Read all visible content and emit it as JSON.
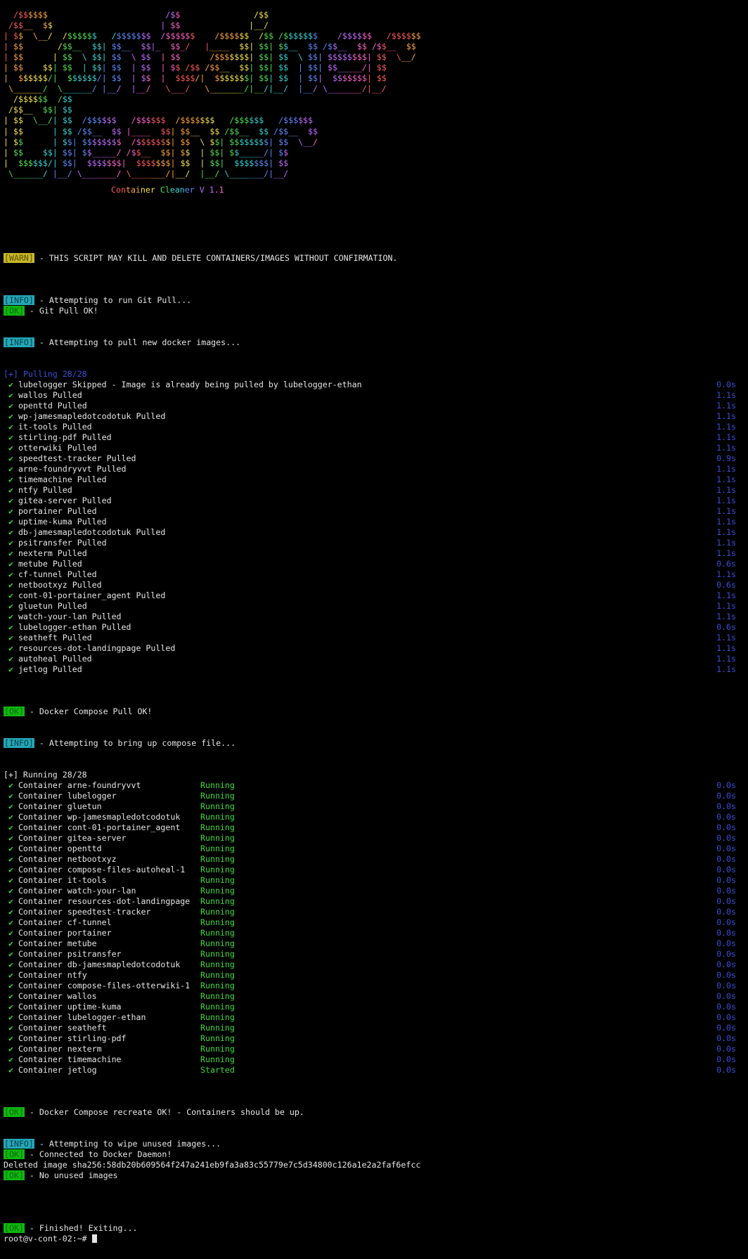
{
  "banner_lines": [
    "  /$$$$$$                        /$$               /$$",
    " /$$__  $$                      | $$              |__/",
    "| $$  \\__/  /$$$$$$   /$$$$$$$  /$$$$$$    /$$$$$$  /$$ /$$$$$$$    /$$$$$$   /$$$$$$",
    "| $$       /$$__  $$| $$__  $$|_  $$_/   |____  $$| $$| $$__  $$ /$$__  $$ /$$__  $$",
    "| $$      | $$  \\ $$| $$  \\ $$  | $$      /$$$$$$$| $$| $$  \\ $$| $$$$$$$$| $$  \\__/",
    "| $$    $$| $$  | $$| $$  | $$  | $$ /$$ /$$__  $$| $$| $$  | $$| $$_____/| $$",
    "|  $$$$$$/|  $$$$$$/| $$  | $$  |  $$$$/|  $$$$$$$| $$| $$  | $$|  $$$$$$$| $$",
    " \\______/  \\______/ |__/  |__/   \\___/   \\_______/|__/|__/  |__/ \\_______/|__/",
    "  /$$$$$$  /$$",
    " /$$__  $$| $$",
    "| $$  \\__/| $$  /$$$$$$   /$$$$$$  /$$$$$$$   /$$$$$$   /$$$$$$",
    "| $$      | $$ /$$__  $$ |____  $$| $$__  $$ /$$__  $$ /$$__  $$",
    "| $$      | $$| $$$$$$$$  /$$$$$$$| $$  \\ $$| $$$$$$$$| $$  \\__/",
    "| $$    $$| $$| $$_____/ /$$__  $$| $$  | $$| $$_____/| $$",
    "|  $$$$$$/| $$|  $$$$$$$|  $$$$$$$| $$  | $$|  $$$$$$$| $$",
    " \\______/ |__/ \\_______/ \\_______/|__/  |__/ \\_______/|__/"
  ],
  "subtitle": "Container Cleaner V 1.1",
  "tags": {
    "warn": "[WARN]",
    "info": "[INFO]",
    "ok": "[OK]"
  },
  "messages": {
    "warn": " - THIS SCRIPT MAY KILL AND DELETE CONTAINERS/IMAGES WITHOUT CONFIRMATION.",
    "git_attempt": " - Attempting to run Git Pull...",
    "git_ok": " - Git Pull OK!",
    "pull_attempt": " - Attempting to pull new docker images...",
    "pull_ok": " - Docker Compose Pull OK!",
    "up_attempt": " - Attempting to bring up compose file...",
    "recreate_ok": " - Docker Compose recreate OK! - Containers should be up.",
    "wipe_attempt": " - Attempting to wipe unused images...",
    "daemon_ok": " - Connected to Docker Daemon!",
    "deleted": "Deleted image sha256:58db20b609564f247a241eb9fa3a83c55779e7c5d34800c126a1e2a2faf6efcc",
    "no_unused": " - No unused images",
    "finished": " - Finished! Exiting..."
  },
  "pulling": {
    "header": "[+] Pulling 28/28",
    "items": [
      {
        "name": "lubelogger Skipped - Image is already being pulled by lubelogger-ethan",
        "time": "0.0s"
      },
      {
        "name": "wallos Pulled",
        "time": "1.1s"
      },
      {
        "name": "openttd Pulled",
        "time": "1.1s"
      },
      {
        "name": "wp-jamesmapledotcodotuk Pulled",
        "time": "1.1s"
      },
      {
        "name": "it-tools Pulled",
        "time": "1.1s"
      },
      {
        "name": "stirling-pdf Pulled",
        "time": "1.1s"
      },
      {
        "name": "otterwiki Pulled",
        "time": "1.1s"
      },
      {
        "name": "speedtest-tracker Pulled",
        "time": "0.9s"
      },
      {
        "name": "arne-foundryvvt Pulled",
        "time": "1.1s"
      },
      {
        "name": "timemachine Pulled",
        "time": "1.1s"
      },
      {
        "name": "ntfy Pulled",
        "time": "1.1s"
      },
      {
        "name": "gitea-server Pulled",
        "time": "1.1s"
      },
      {
        "name": "portainer Pulled",
        "time": "1.1s"
      },
      {
        "name": "uptime-kuma Pulled",
        "time": "1.1s"
      },
      {
        "name": "db-jamesmapledotcodotuk Pulled",
        "time": "1.1s"
      },
      {
        "name": "psitransfer Pulled",
        "time": "1.1s"
      },
      {
        "name": "nexterm Pulled",
        "time": "1.1s"
      },
      {
        "name": "metube Pulled",
        "time": "0.6s"
      },
      {
        "name": "cf-tunnel Pulled",
        "time": "1.1s"
      },
      {
        "name": "netbootxyz Pulled",
        "time": "0.6s"
      },
      {
        "name": "cont-01-portainer_agent Pulled",
        "time": "1.1s"
      },
      {
        "name": "gluetun Pulled",
        "time": "1.1s"
      },
      {
        "name": "watch-your-lan Pulled",
        "time": "1.1s"
      },
      {
        "name": "lubelogger-ethan Pulled",
        "time": "0.6s"
      },
      {
        "name": "seatheft Pulled",
        "time": "1.1s"
      },
      {
        "name": "resources-dot-landingpage Pulled",
        "time": "1.1s"
      },
      {
        "name": "autoheal Pulled",
        "time": "1.1s"
      },
      {
        "name": "jetlog Pulled",
        "time": "1.1s"
      }
    ]
  },
  "running": {
    "header": "[+] Running 28/28",
    "items": [
      {
        "name": "Container arne-foundryvvt",
        "status": "Running",
        "time": "0.0s"
      },
      {
        "name": "Container lubelogger",
        "status": "Running",
        "time": "0.0s"
      },
      {
        "name": "Container gluetun",
        "status": "Running",
        "time": "0.0s"
      },
      {
        "name": "Container wp-jamesmapledotcodotuk",
        "status": "Running",
        "time": "0.0s"
      },
      {
        "name": "Container cont-01-portainer_agent",
        "status": "Running",
        "time": "0.0s"
      },
      {
        "name": "Container gitea-server",
        "status": "Running",
        "time": "0.0s"
      },
      {
        "name": "Container openttd",
        "status": "Running",
        "time": "0.0s"
      },
      {
        "name": "Container netbootxyz",
        "status": "Running",
        "time": "0.0s"
      },
      {
        "name": "Container compose-files-autoheal-1",
        "status": "Running",
        "time": "0.0s"
      },
      {
        "name": "Container it-tools",
        "status": "Running",
        "time": "0.0s"
      },
      {
        "name": "Container watch-your-lan",
        "status": "Running",
        "time": "0.0s"
      },
      {
        "name": "Container resources-dot-landingpage",
        "status": "Running",
        "time": "0.0s"
      },
      {
        "name": "Container speedtest-tracker",
        "status": "Running",
        "time": "0.0s"
      },
      {
        "name": "Container cf-tunnel",
        "status": "Running",
        "time": "0.0s"
      },
      {
        "name": "Container portainer",
        "status": "Running",
        "time": "0.0s"
      },
      {
        "name": "Container metube",
        "status": "Running",
        "time": "0.0s"
      },
      {
        "name": "Container psitransfer",
        "status": "Running",
        "time": "0.0s"
      },
      {
        "name": "Container db-jamesmapledotcodotuk",
        "status": "Running",
        "time": "0.0s"
      },
      {
        "name": "Container ntfy",
        "status": "Running",
        "time": "0.0s"
      },
      {
        "name": "Container compose-files-otterwiki-1",
        "status": "Running",
        "time": "0.0s"
      },
      {
        "name": "Container wallos",
        "status": "Running",
        "time": "0.0s"
      },
      {
        "name": "Container uptime-kuma",
        "status": "Running",
        "time": "0.0s"
      },
      {
        "name": "Container lubelogger-ethan",
        "status": "Running",
        "time": "0.0s"
      },
      {
        "name": "Container seatheft",
        "status": "Running",
        "time": "0.0s"
      },
      {
        "name": "Container stirling-pdf",
        "status": "Running",
        "time": "0.0s"
      },
      {
        "name": "Container nexterm",
        "status": "Running",
        "time": "0.0s"
      },
      {
        "name": "Container timemachine",
        "status": "Running",
        "time": "0.0s"
      },
      {
        "name": "Container jetlog",
        "status": "Started",
        "time": "0.0s"
      }
    ]
  },
  "prompt": "root@v-cont-02:~# ",
  "tick_glyph": "✔",
  "colors": {
    "warn": "#c8b829",
    "info": "#23a7b7",
    "ok": "#0fb80f",
    "time": "#3a4fd6",
    "running": "#3ddc3d",
    "background": "#000000"
  }
}
